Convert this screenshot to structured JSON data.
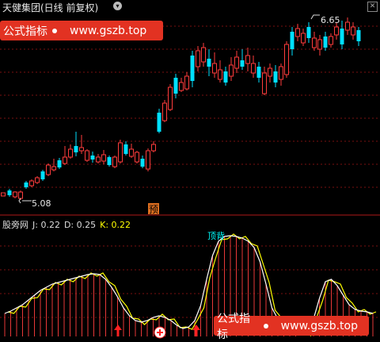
{
  "header": {
    "title": "天健集团(日线 前复权)",
    "caret_glyph": "▾",
    "corner_glyph": "✕"
  },
  "price_panel": {
    "high_label": "6.65",
    "low_label": "5.08",
    "signal_label": "预"
  },
  "indicator_panel": {
    "name": "股旁网",
    "j_text": "J: 0.22",
    "d_text": "D: 0.25",
    "k_text": "K: 0.22",
    "annotation": "顶背"
  },
  "watermark": {
    "left_text": "公式指标",
    "right_text": "www.gszb.top"
  },
  "colors": {
    "up": "#ff3c3c",
    "down": "#00e0ff",
    "k_line": "#ffffff",
    "d_line": "#ffff00",
    "grid": "#7a1010",
    "divider": "#b01818"
  }
}
